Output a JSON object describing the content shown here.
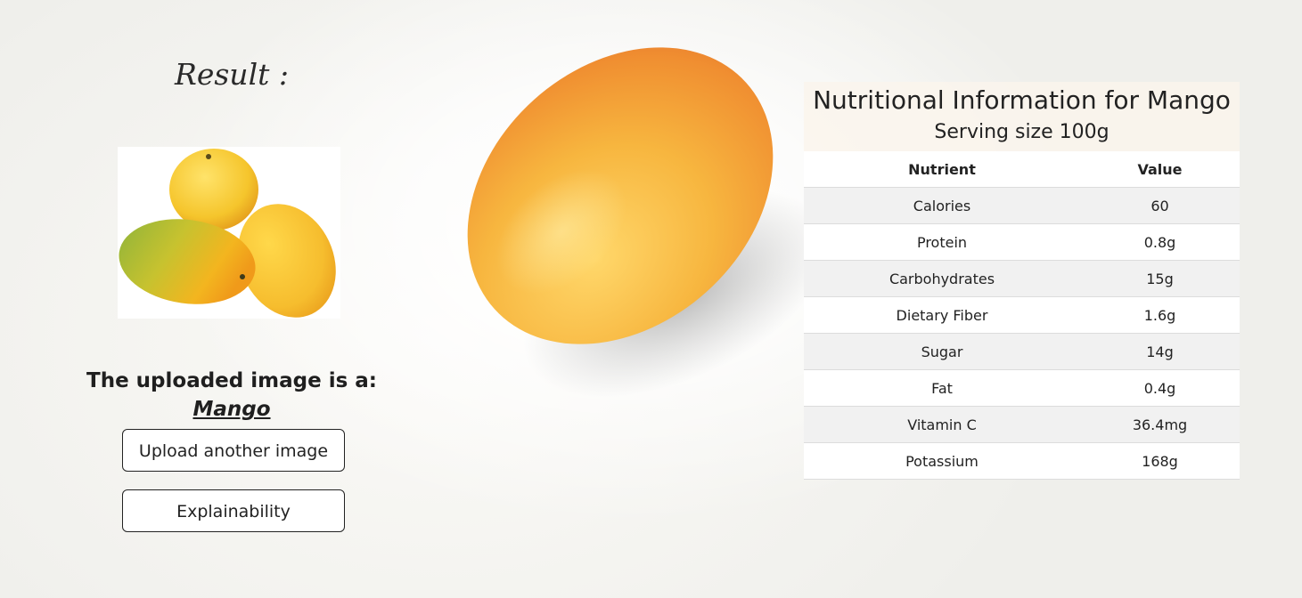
{
  "result": {
    "title": "Result :",
    "prefix": "The uploaded image is a:",
    "fruit": "Mango"
  },
  "buttons": {
    "upload": "Upload another image",
    "explain": "Explainability"
  },
  "nutrition": {
    "title": "Nutritional Information for Mango",
    "serving": "Serving size 100g",
    "headers": [
      "Nutrient",
      "Value"
    ],
    "rows": [
      [
        "Calories",
        "60"
      ],
      [
        "Protein",
        "0.8g"
      ],
      [
        "Carbohydrates",
        "15g"
      ],
      [
        "Dietary Fiber",
        "1.6g"
      ],
      [
        "Sugar",
        "14g"
      ],
      [
        "Fat",
        "0.4g"
      ],
      [
        "Vitamin C",
        "36.4mg"
      ],
      [
        "Potassium",
        "168g"
      ]
    ]
  },
  "colors": {
    "mango_yellow": "#f6bd2e",
    "mango_orange": "#ef8a2a",
    "mango_green": "#8fb43a",
    "stripe": "#f1f1f1"
  }
}
